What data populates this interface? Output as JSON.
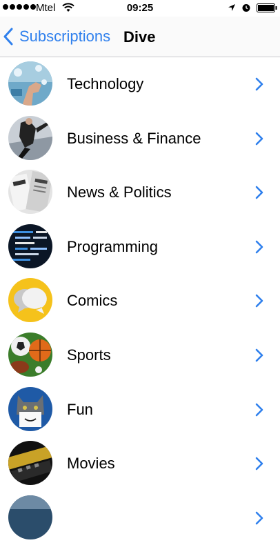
{
  "status_bar": {
    "carrier": "Mtel",
    "time": "09:25"
  },
  "nav": {
    "back_label": "Subscriptions",
    "title": "Dive"
  },
  "categories": [
    {
      "label": "Technology"
    },
    {
      "label": "Business & Finance"
    },
    {
      "label": "News & Politics"
    },
    {
      "label": "Programming"
    },
    {
      "label": "Comics"
    },
    {
      "label": "Sports"
    },
    {
      "label": "Fun"
    },
    {
      "label": "Movies"
    },
    {
      "label": ""
    }
  ],
  "colors": {
    "accent": "#2f80ed",
    "separator": "#c8c7cc"
  }
}
